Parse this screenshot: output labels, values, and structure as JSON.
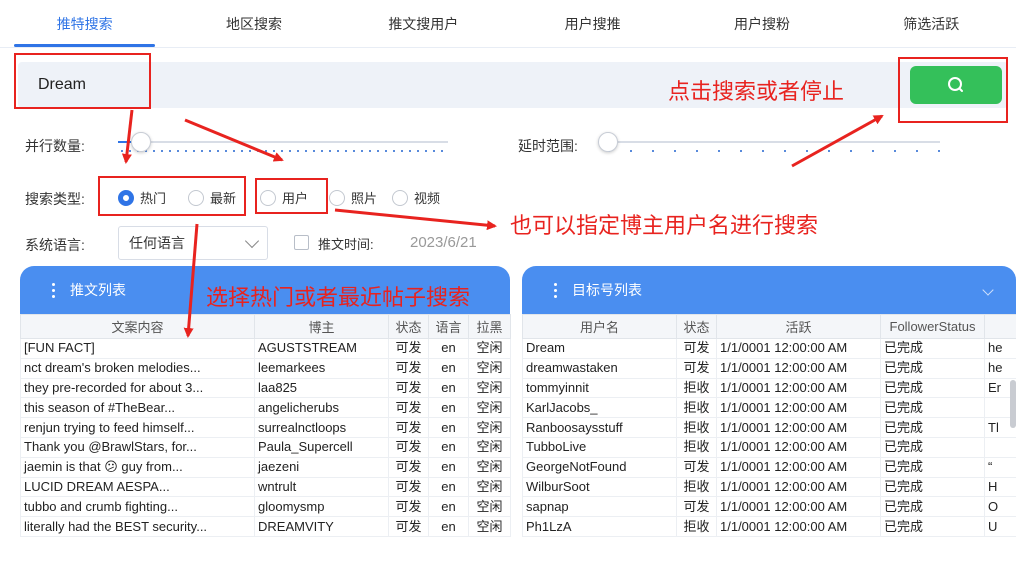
{
  "tabs": [
    {
      "label": "推特搜索",
      "active": true
    },
    {
      "label": "地区搜索",
      "active": false
    },
    {
      "label": "推文搜用户",
      "active": false
    },
    {
      "label": "用户搜推",
      "active": false
    },
    {
      "label": "用户搜粉",
      "active": false
    },
    {
      "label": "筛选活跃",
      "active": false
    }
  ],
  "search": {
    "value": "Dream",
    "button_icon": "search-icon"
  },
  "parallel": {
    "label": "并行数量:",
    "level_percent": 5
  },
  "delay": {
    "label": "延时范围:",
    "level_percent": 0
  },
  "search_type": {
    "label": "搜索类型:",
    "options": [
      {
        "label": "热门",
        "selected": true
      },
      {
        "label": "最新",
        "selected": false
      },
      {
        "label": "用户",
        "selected": false
      },
      {
        "label": "照片",
        "selected": false
      },
      {
        "label": "视频",
        "selected": false
      }
    ]
  },
  "language": {
    "label": "系统语言:",
    "selected": "任何语言"
  },
  "tweet_time": {
    "label": "推文时间:",
    "checked": false,
    "value": "2023/6/21"
  },
  "tweets_panel": {
    "title": "推文列表",
    "columns": [
      "文案内容",
      "博主",
      "状态",
      "语言",
      "拉黑"
    ],
    "rows": [
      [
        "[FUN FACT]",
        "AGUSTSTREAM",
        "可发",
        "en",
        "空闲"
      ],
      [
        "nct dream's broken melodies...",
        "leemarkees",
        "可发",
        "en",
        "空闲"
      ],
      [
        "they pre-recorded for about 3...",
        "laa825",
        "可发",
        "en",
        "空闲"
      ],
      [
        "this season of #TheBear...",
        "angelicherubs",
        "可发",
        "en",
        "空闲"
      ],
      [
        "renjun trying to feed himself...",
        "surrealnctloops",
        "可发",
        "en",
        "空闲"
      ],
      [
        "Thank you @BrawlStars, for...",
        "Paula_Supercell",
        "可发",
        "en",
        "空闲"
      ],
      [
        "jaemin is that 😕 guy from...",
        "jaezeni",
        "可发",
        "en",
        "空闲"
      ],
      [
        "LUCID DREAM AESPA...",
        "wntrult",
        "可发",
        "en",
        "空闲"
      ],
      [
        "tubbo and crumb fighting...",
        "gloomysmp",
        "可发",
        "en",
        "空闲"
      ],
      [
        "literally had the BEST security...",
        "DREAMVITY",
        "可发",
        "en",
        "空闲"
      ]
    ]
  },
  "targets_panel": {
    "title": "目标号列表",
    "columns": [
      "用户名",
      "状态",
      "活跃",
      "FollowerStatus",
      ""
    ],
    "rows": [
      [
        "Dream",
        "可发",
        "1/1/0001 12:00:00 AM",
        "已完成",
        "he"
      ],
      [
        "dreamwastaken",
        "可发",
        "1/1/0001 12:00:00 AM",
        "已完成",
        "he"
      ],
      [
        "tommyinnit",
        "拒收",
        "1/1/0001 12:00:00 AM",
        "已完成",
        "Er"
      ],
      [
        "KarlJacobs_",
        "拒收",
        "1/1/0001 12:00:00 AM",
        "已完成",
        ""
      ],
      [
        "Ranboosaysstuff",
        "拒收",
        "1/1/0001 12:00:00 AM",
        "已完成",
        "Tl"
      ],
      [
        "TubboLive",
        "拒收",
        "1/1/0001 12:00:00 AM",
        "已完成",
        ""
      ],
      [
        "GeorgeNotFound",
        "可发",
        "1/1/0001 12:00:00 AM",
        "已完成",
        "“"
      ],
      [
        "WilburSoot",
        "拒收",
        "1/1/0001 12:00:00 AM",
        "已完成",
        "H"
      ],
      [
        "sapnap",
        "可发",
        "1/1/0001 12:00:00 AM",
        "已完成",
        "O"
      ],
      [
        "Ph1LzA",
        "拒收",
        "1/1/0001 12:00:00 AM",
        "已完成",
        "U"
      ]
    ]
  },
  "annotations": {
    "click_search": "点击搜索或者停止",
    "user_search": "也可以指定博主用户名进行搜索",
    "choose_type": "选择热门或者最近帖子搜索"
  },
  "colors": {
    "accent": "#2f74e6",
    "panel_header": "#4a8ef0",
    "search_button": "#34c05a",
    "annotation": "#e8231f"
  }
}
